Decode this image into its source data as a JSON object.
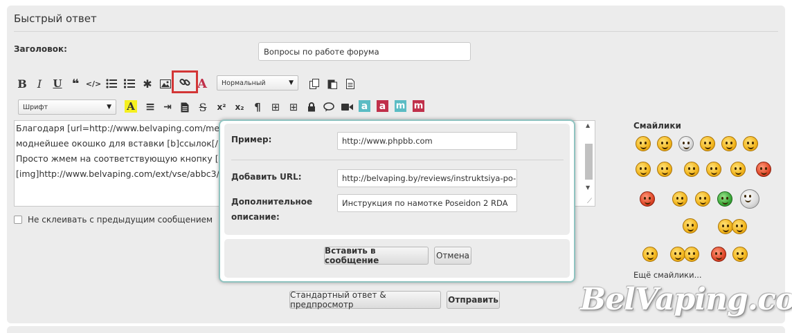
{
  "quick_reply": {
    "title": "Быстрый ответ",
    "subject_label": "Заголовок:",
    "subject_value": "Вопросы по работе форума"
  },
  "toolbar": {
    "row1": [
      {
        "icon": "bold-icon",
        "glyph": "B"
      },
      {
        "icon": "italic-icon",
        "glyph": "I"
      },
      {
        "icon": "underline-icon",
        "glyph": "U"
      },
      {
        "icon": "quote-icon",
        "glyph": "❝"
      },
      {
        "icon": "code-icon",
        "glyph": "</>"
      },
      {
        "icon": "bullet-list-icon",
        "glyph": "☰"
      },
      {
        "icon": "numbered-list-icon",
        "glyph": "☷"
      },
      {
        "icon": "list-item-icon",
        "glyph": "✱"
      },
      {
        "icon": "image-icon",
        "glyph": "▣"
      },
      {
        "icon": "link-icon",
        "glyph": "🔗"
      },
      {
        "icon": "font-color-icon",
        "glyph": "A"
      }
    ],
    "size_select": "Нормальный",
    "row1_right": [
      {
        "icon": "copy-icon"
      },
      {
        "icon": "paste-icon"
      },
      {
        "icon": "document-icon"
      }
    ],
    "font_select": "Шрифт",
    "row2": [
      {
        "icon": "highlight-icon",
        "glyph": "A"
      },
      {
        "icon": "align-center-icon",
        "glyph": "≡"
      },
      {
        "icon": "indent-icon",
        "glyph": "⇥"
      },
      {
        "icon": "page-icon",
        "glyph": "▤"
      },
      {
        "icon": "strikethrough-icon",
        "glyph": "S"
      },
      {
        "icon": "superscript-icon",
        "glyph": "x²"
      },
      {
        "icon": "subscript-icon",
        "glyph": "x₂"
      },
      {
        "icon": "paragraph-icon",
        "glyph": "¶"
      },
      {
        "icon": "table-icon",
        "glyph": "⊞"
      },
      {
        "icon": "table-cell-icon",
        "glyph": "⊞"
      },
      {
        "icon": "lock-icon",
        "glyph": "🔒"
      },
      {
        "icon": "comment-icon",
        "glyph": "💬"
      },
      {
        "icon": "video-icon",
        "glyph": "■"
      },
      {
        "icon": "letter-a-teal-icon",
        "glyph": "a"
      },
      {
        "icon": "letter-a-red-icon",
        "glyph": "a"
      },
      {
        "icon": "letter-m-teal-icon",
        "glyph": "m"
      },
      {
        "icon": "letter-m-red-icon",
        "glyph": "m"
      }
    ]
  },
  "editor": {
    "lines": [
      "Благодаря [url=http://www.belvaping.com/mem",
      "моднейшее окошко для вставки [b]ссылок[/b]",
      "Просто жмем на соответствующую кнопку [im",
      "[img]http://www.belvaping.com/ext/vse/abbc3/"
    ]
  },
  "no_merge_label": "Не склеивать с предыдущим сообщением",
  "buttons": {
    "preview": "Стандартный ответ & предпросмотр",
    "submit": "Отправить"
  },
  "smilies": {
    "title": "Смайлики",
    "more": "Ещё смайлики..."
  },
  "link_dialog": {
    "example_label": "Пример:",
    "example_value": "http://www.phpbb.com",
    "url_label": "Добавить URL:",
    "url_value": "http://belvaping.by/reviews/instruktsiya-po-na",
    "desc_label_1": "Дополнительное",
    "desc_label_2": "описание:",
    "desc_value": "Инструкция по намотке Poseidon 2 RDA",
    "insert_button": "Вставить в сообщение",
    "cancel_button": "Отмена"
  },
  "watermark": "BelVaping.com",
  "colors": {
    "panel_bg": "#ececec",
    "dialog_border": "#8fc3c0",
    "highlight_border": "#d33636",
    "teal_icon": "#5bbcc4",
    "red_icon": "#c0304a"
  }
}
